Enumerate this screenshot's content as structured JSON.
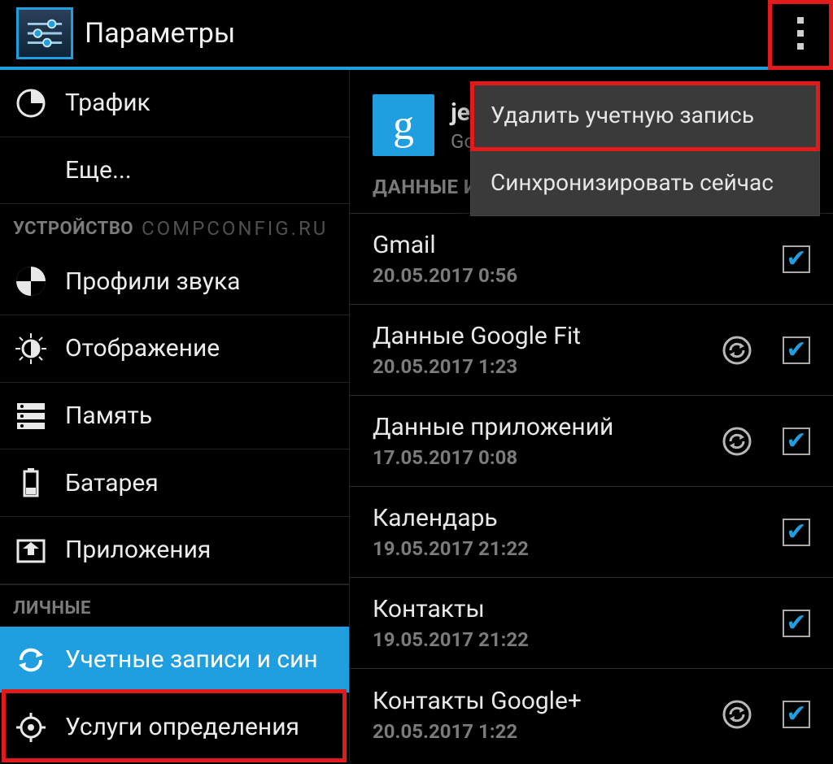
{
  "header": {
    "title": "Параметры"
  },
  "sidebar": {
    "items": [
      {
        "icon": "traffic-icon",
        "label": "Трафик"
      },
      {
        "icon": "",
        "label": "Еще..."
      }
    ],
    "cat_device": "УСТРОЙСТВО",
    "watermark": "COMPCONFIG.RU",
    "device_items": [
      {
        "icon": "sound-profile-icon",
        "label": "Профили звука"
      },
      {
        "icon": "display-icon",
        "label": "Отображение"
      },
      {
        "icon": "storage-icon",
        "label": "Память"
      },
      {
        "icon": "battery-icon",
        "label": "Батарея"
      },
      {
        "icon": "apps-icon",
        "label": "Приложения"
      }
    ],
    "cat_personal": "ЛИЧНЫЕ",
    "personal_items": [
      {
        "icon": "sync-icon",
        "label": "Учетные записи и син",
        "selected": true
      },
      {
        "icon": "location-icon",
        "label": "Услуги определения ",
        "selected": false
      }
    ]
  },
  "account": {
    "logo_letter": "g",
    "name": "jer",
    "provider": "Go",
    "section_label": "ДАННЫЕ И"
  },
  "sync_items": [
    {
      "name": "Gmail",
      "time": "20.05.2017 0:56",
      "refresh": false,
      "checked": true
    },
    {
      "name": "Данные Google Fit",
      "time": "20.05.2017 1:23",
      "refresh": true,
      "checked": true
    },
    {
      "name": "Данные приложений",
      "time": "17.05.2017 0:08",
      "refresh": true,
      "checked": true
    },
    {
      "name": "Календарь",
      "time": "19.05.2017 21:22",
      "refresh": false,
      "checked": true
    },
    {
      "name": "Контакты",
      "time": "19.05.2017 21:22",
      "refresh": false,
      "checked": true
    },
    {
      "name": "Контакты Google+",
      "time": "20.05.2017 1:22",
      "refresh": true,
      "checked": true
    }
  ],
  "menu": {
    "items": [
      {
        "label": "Удалить учетную запись"
      },
      {
        "label": "Синхронизировать сейчас"
      }
    ]
  }
}
